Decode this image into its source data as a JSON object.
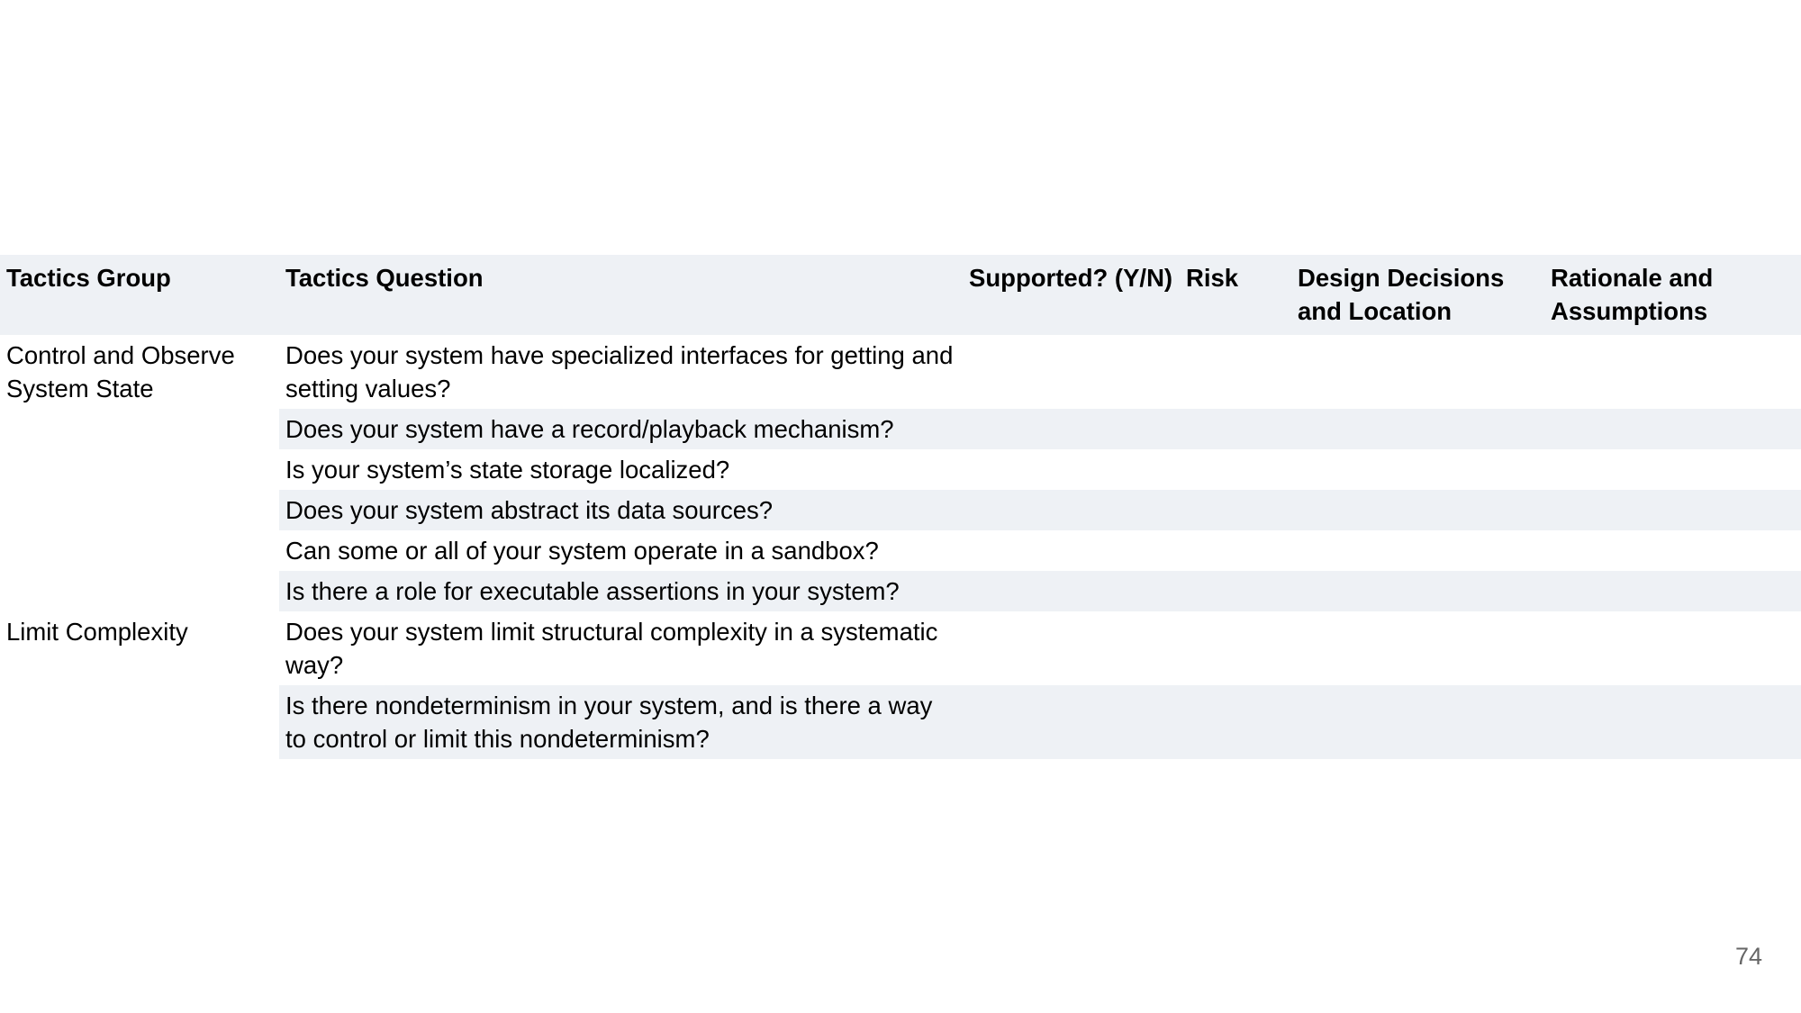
{
  "table": {
    "headers": [
      "Tactics Group",
      "Tactics Question",
      "Supported? (Y/N)",
      "Risk",
      "Design Decisions and Location",
      "Rationale and Assumptions"
    ],
    "groups": [
      {
        "name": "Control and Observe System State",
        "questions": [
          "Does your system have specialized interfaces for getting and setting values?",
          "Does your system have a record/playback mechanism?",
          "Is your system’s state storage localized?",
          "Does your system abstract its data sources?",
          "Can some or all of your system operate in a sandbox?",
          "Is there a role for executable assertions in your system?"
        ]
      },
      {
        "name": "Limit Complexity",
        "questions": [
          "Does your system limit structural complexity in a systematic way?",
          "Is there nondeterminism in your system, and is there a way to control or limit this nondeterminism?"
        ]
      }
    ]
  },
  "page_number": "74",
  "colors": {
    "header_background": "#eef1f5",
    "shaded_row_background": "#eef1f5",
    "text": "#000000",
    "page_number": "#666666"
  }
}
